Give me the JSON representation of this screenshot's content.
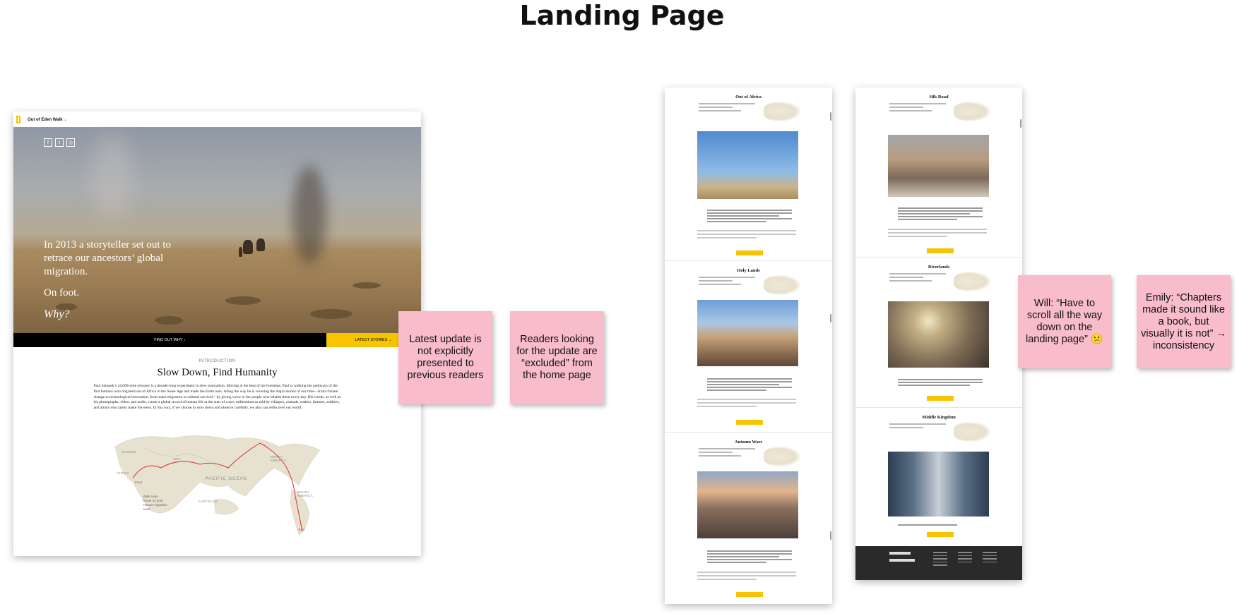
{
  "board": {
    "title": "Landing Page"
  },
  "landing": {
    "nav": {
      "brand": "Out of Eden Walk",
      "chevron_icon": "chevron-down-icon"
    },
    "social_icons": [
      "f",
      "t",
      "◎"
    ],
    "hero": {
      "line1": "In 2013 a storyteller set out to retrace our ancestors’ global migration.",
      "line2": "On foot.",
      "line3": "Why?"
    },
    "bar": {
      "find_out": "FIND OUT WHY ↓",
      "latest": "LATEST STORIES →"
    },
    "intro": {
      "kicker": "INTRODUCTION",
      "title": "Slow Down, Find Humanity",
      "body": "Paul Salopek’s 24,000-mile odyssey is a decade-long experiment in slow journalism. Moving at the beat of his footsteps, Paul is walking the pathways of the first humans who migrated out of Africa in the Stone Age and made the Earth ours. Along the way he is covering the major stories of our time—from climate change to technological innovation, from mass migration to cultural survival—by giving voice to the people who inhabit them every day. His words, as well as his photographs, video, and audio, create a global record of human life at the start of a new millennium as told by villagers, nomads, traders, farmers, soldiers, and artists who rarely make the news. In this way, if we choose to slow down and observe carefully, we also can rediscover our world."
    },
    "map": {
      "labels": {
        "europe": "EUROPE",
        "asia": "ASIA",
        "africa": "AFRICA",
        "north_america": "NORTH AMERICA",
        "pacific": "PACIFIC OCEAN",
        "south_america": "SOUTH AMERICA",
        "australia": "AUSTRALIA",
        "start": "Start",
        "end": "End"
      },
      "legend": [
        "Walk route",
        "Route by boat",
        "Human migration route"
      ]
    }
  },
  "notes": {
    "latest_update": "Latest update is not explicitly presented to previous readers",
    "excluded": "Readers looking for the update are “excluded” from the home page",
    "will": "Will: “Have to scroll all the way down on the landing page” 😕",
    "emily": "Emily: “Chapters made it sound like a book, but visually it is not” → inconsistency"
  },
  "chapters": {
    "col1": [
      "Out of Africa",
      "Holy Lands",
      "Autumn Wars"
    ],
    "col2": [
      "Silk Road",
      "Riverlands",
      "Middle Kingdom"
    ]
  }
}
